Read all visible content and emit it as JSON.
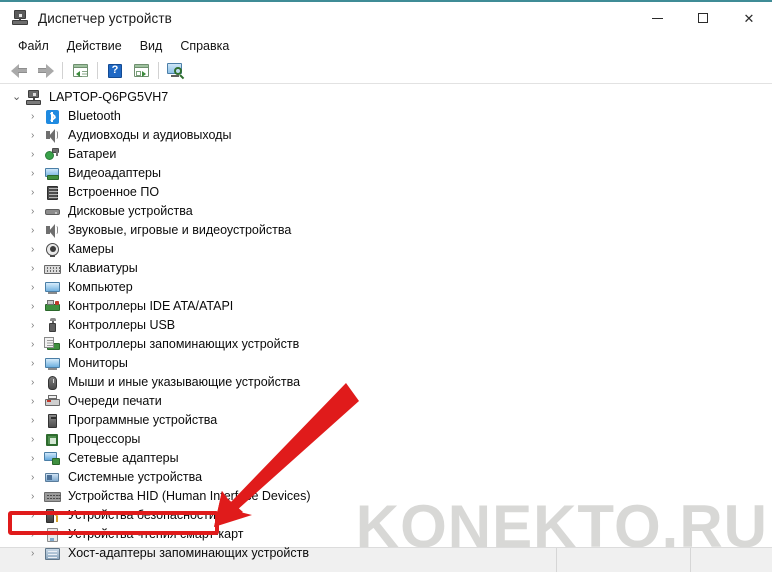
{
  "window": {
    "title": "Диспетчер устройств",
    "title_icon": "device-manager-icon",
    "accent_color": "#3f8c96",
    "controls": {
      "minimize": "—",
      "maximize": "□",
      "close": "✕"
    }
  },
  "menubar": {
    "items": [
      {
        "label": "Файл"
      },
      {
        "label": "Действие"
      },
      {
        "label": "Вид"
      },
      {
        "label": "Справка"
      }
    ]
  },
  "toolbar": {
    "buttons": [
      {
        "name": "back-arrow-icon",
        "tooltip": "Назад"
      },
      {
        "name": "forward-arrow-icon",
        "tooltip": "Вперед"
      },
      {
        "name": "properties-icon",
        "tooltip": "Свойства"
      },
      {
        "name": "help-icon",
        "tooltip": "Справка"
      },
      {
        "name": "update-driver-icon",
        "tooltip": "Обновить конфигурацию оборудования"
      },
      {
        "name": "scan-hardware-icon",
        "tooltip": "Сканировать оборудование"
      }
    ]
  },
  "tree": {
    "root": {
      "label": "LAPTOP-Q6PG5VH7",
      "icon": "computer-root-icon",
      "expanded": true,
      "chevron": "⌄"
    },
    "chevron_collapsed": "›",
    "items": [
      {
        "label": "Bluetooth",
        "icon": "bluetooth-icon",
        "icon_class": "i-bt"
      },
      {
        "label": "Аудиовходы и аудиовыходы",
        "icon": "audio-io-icon",
        "icon_class": "i-spk"
      },
      {
        "label": "Батареи",
        "icon": "battery-icon",
        "icon_class": "i-bat"
      },
      {
        "label": "Видеоадаптеры",
        "icon": "display-adapter-icon",
        "icon_class": "i-vid"
      },
      {
        "label": "Встроенное ПО",
        "icon": "firmware-icon",
        "icon_class": "i-fw"
      },
      {
        "label": "Дисковые устройства",
        "icon": "disk-drive-icon",
        "icon_class": "i-disk"
      },
      {
        "label": "Звуковые, игровые и видеоустройства",
        "icon": "sound-video-game-icon",
        "icon_class": "i-spk"
      },
      {
        "label": "Камеры",
        "icon": "camera-icon",
        "icon_class": "i-cam"
      },
      {
        "label": "Клавиатуры",
        "icon": "keyboard-icon",
        "icon_class": "i-kbd"
      },
      {
        "label": "Компьютер",
        "icon": "computer-icon",
        "icon_class": "i-pc"
      },
      {
        "label": "Контроллеры IDE ATA/ATAPI",
        "icon": "ide-controller-icon",
        "icon_class": "i-ide"
      },
      {
        "label": "Контроллеры USB",
        "icon": "usb-controller-icon",
        "icon_class": "i-usb"
      },
      {
        "label": "Контроллеры запоминающих устройств",
        "icon": "storage-controller-icon",
        "icon_class": "i-stor"
      },
      {
        "label": "Мониторы",
        "icon": "monitor-icon",
        "icon_class": "i-mon"
      },
      {
        "label": "Мыши и иные указывающие устройства",
        "icon": "mouse-icon",
        "icon_class": "i-mouse"
      },
      {
        "label": "Очереди печати",
        "icon": "printer-icon",
        "icon_class": "i-print"
      },
      {
        "label": "Программные устройства",
        "icon": "software-device-icon",
        "icon_class": "i-soft"
      },
      {
        "label": "Процессоры",
        "icon": "processor-icon",
        "icon_class": "i-cpu"
      },
      {
        "label": "Сетевые адаптеры",
        "icon": "network-adapter-icon",
        "icon_class": "i-net",
        "highlighted": true
      },
      {
        "label": "Системные устройства",
        "icon": "system-device-icon",
        "icon_class": "i-sys"
      },
      {
        "label": "Устройства HID (Human Interface Devices)",
        "icon": "hid-device-icon",
        "icon_class": "i-hid"
      },
      {
        "label": "Устройства безопасности",
        "icon": "security-device-icon",
        "icon_class": "i-sec"
      },
      {
        "label": "Устройства чтения смарт-карт",
        "icon": "smart-card-reader-icon",
        "icon_class": "i-smart"
      },
      {
        "label": "Хост-адаптеры запоминающих устройств",
        "icon": "storage-host-adapter-icon",
        "icon_class": "i-host"
      }
    ]
  },
  "annotations": {
    "highlight_target": "Сетевые адаптеры",
    "highlight_color": "#e01b1b",
    "arrow_color": "#e01b1b",
    "arrow_direction": "down-left"
  },
  "watermark": {
    "text": "KONEKTO.RU",
    "color": "#d2d2d0"
  },
  "statusbar": {
    "main": "",
    "middle": "",
    "end": ""
  }
}
